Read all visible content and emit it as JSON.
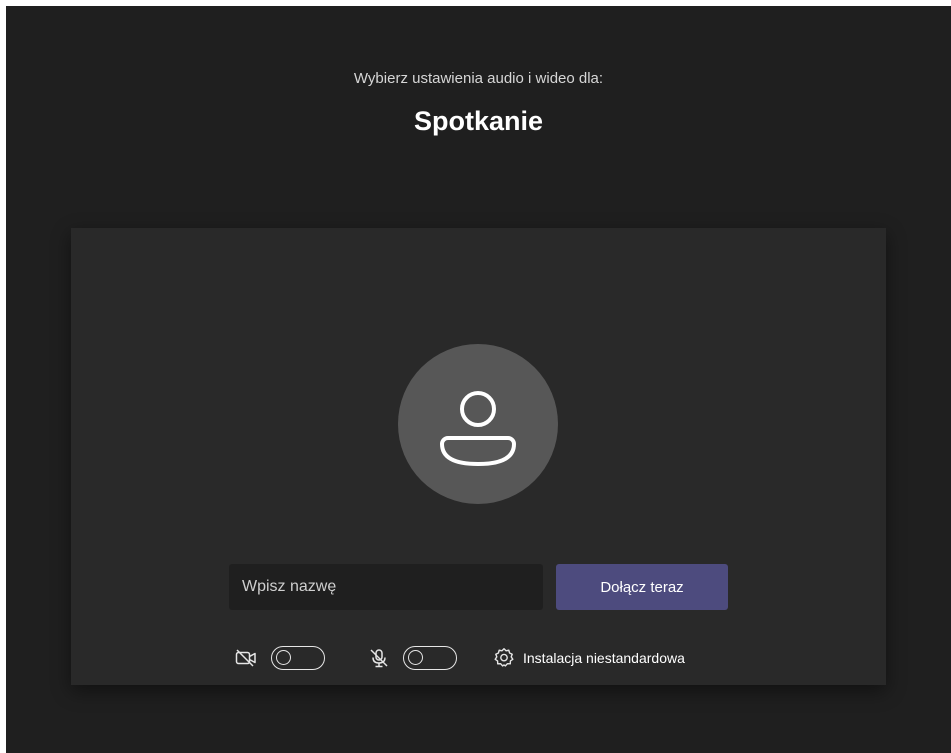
{
  "header": {
    "subtitle": "Wybierz ustawienia audio i wideo dla:",
    "meeting_name": "Spotkanie"
  },
  "avatar": {
    "icon": "person-icon"
  },
  "join": {
    "name_placeholder": "Wpisz nazwę",
    "name_value": "",
    "join_label": "Dołącz teraz"
  },
  "controls": {
    "camera": {
      "icon": "camera-off-icon",
      "on": false
    },
    "mic": {
      "icon": "mic-off-icon",
      "on": false
    },
    "settings": {
      "icon": "gear-icon",
      "label": "Instalacja niestandardowa"
    }
  },
  "colors": {
    "background": "#1f1f1f",
    "panel": "#292929",
    "avatar_circle": "#575757",
    "join_button": "#4d4b7e",
    "text": "#ffffff"
  }
}
